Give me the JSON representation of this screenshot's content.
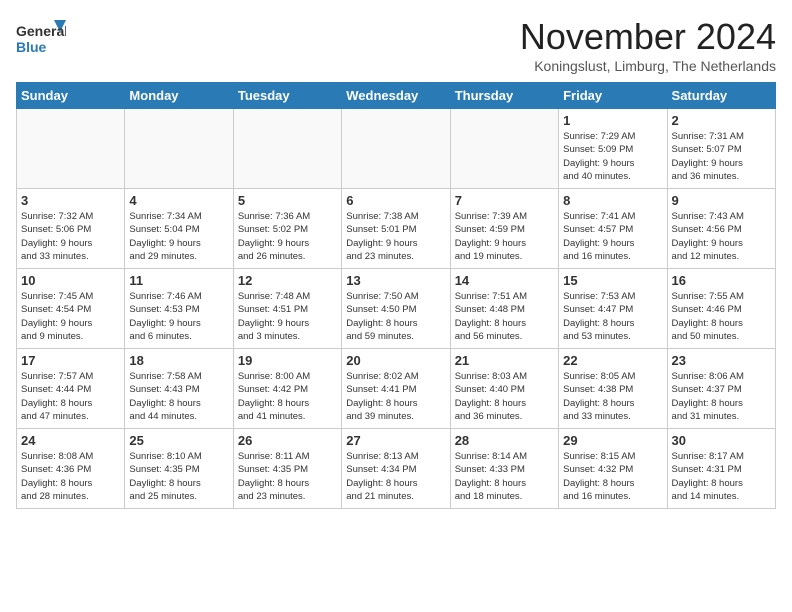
{
  "logo": {
    "general": "General",
    "blue": "Blue"
  },
  "header": {
    "month": "November 2024",
    "location": "Koningslust, Limburg, The Netherlands"
  },
  "weekdays": [
    "Sunday",
    "Monday",
    "Tuesday",
    "Wednesday",
    "Thursday",
    "Friday",
    "Saturday"
  ],
  "weeks": [
    [
      {
        "day": "",
        "info": ""
      },
      {
        "day": "",
        "info": ""
      },
      {
        "day": "",
        "info": ""
      },
      {
        "day": "",
        "info": ""
      },
      {
        "day": "",
        "info": ""
      },
      {
        "day": "1",
        "info": "Sunrise: 7:29 AM\nSunset: 5:09 PM\nDaylight: 9 hours\nand 40 minutes."
      },
      {
        "day": "2",
        "info": "Sunrise: 7:31 AM\nSunset: 5:07 PM\nDaylight: 9 hours\nand 36 minutes."
      }
    ],
    [
      {
        "day": "3",
        "info": "Sunrise: 7:32 AM\nSunset: 5:06 PM\nDaylight: 9 hours\nand 33 minutes."
      },
      {
        "day": "4",
        "info": "Sunrise: 7:34 AM\nSunset: 5:04 PM\nDaylight: 9 hours\nand 29 minutes."
      },
      {
        "day": "5",
        "info": "Sunrise: 7:36 AM\nSunset: 5:02 PM\nDaylight: 9 hours\nand 26 minutes."
      },
      {
        "day": "6",
        "info": "Sunrise: 7:38 AM\nSunset: 5:01 PM\nDaylight: 9 hours\nand 23 minutes."
      },
      {
        "day": "7",
        "info": "Sunrise: 7:39 AM\nSunset: 4:59 PM\nDaylight: 9 hours\nand 19 minutes."
      },
      {
        "day": "8",
        "info": "Sunrise: 7:41 AM\nSunset: 4:57 PM\nDaylight: 9 hours\nand 16 minutes."
      },
      {
        "day": "9",
        "info": "Sunrise: 7:43 AM\nSunset: 4:56 PM\nDaylight: 9 hours\nand 12 minutes."
      }
    ],
    [
      {
        "day": "10",
        "info": "Sunrise: 7:45 AM\nSunset: 4:54 PM\nDaylight: 9 hours\nand 9 minutes."
      },
      {
        "day": "11",
        "info": "Sunrise: 7:46 AM\nSunset: 4:53 PM\nDaylight: 9 hours\nand 6 minutes."
      },
      {
        "day": "12",
        "info": "Sunrise: 7:48 AM\nSunset: 4:51 PM\nDaylight: 9 hours\nand 3 minutes."
      },
      {
        "day": "13",
        "info": "Sunrise: 7:50 AM\nSunset: 4:50 PM\nDaylight: 8 hours\nand 59 minutes."
      },
      {
        "day": "14",
        "info": "Sunrise: 7:51 AM\nSunset: 4:48 PM\nDaylight: 8 hours\nand 56 minutes."
      },
      {
        "day": "15",
        "info": "Sunrise: 7:53 AM\nSunset: 4:47 PM\nDaylight: 8 hours\nand 53 minutes."
      },
      {
        "day": "16",
        "info": "Sunrise: 7:55 AM\nSunset: 4:46 PM\nDaylight: 8 hours\nand 50 minutes."
      }
    ],
    [
      {
        "day": "17",
        "info": "Sunrise: 7:57 AM\nSunset: 4:44 PM\nDaylight: 8 hours\nand 47 minutes."
      },
      {
        "day": "18",
        "info": "Sunrise: 7:58 AM\nSunset: 4:43 PM\nDaylight: 8 hours\nand 44 minutes."
      },
      {
        "day": "19",
        "info": "Sunrise: 8:00 AM\nSunset: 4:42 PM\nDaylight: 8 hours\nand 41 minutes."
      },
      {
        "day": "20",
        "info": "Sunrise: 8:02 AM\nSunset: 4:41 PM\nDaylight: 8 hours\nand 39 minutes."
      },
      {
        "day": "21",
        "info": "Sunrise: 8:03 AM\nSunset: 4:40 PM\nDaylight: 8 hours\nand 36 minutes."
      },
      {
        "day": "22",
        "info": "Sunrise: 8:05 AM\nSunset: 4:38 PM\nDaylight: 8 hours\nand 33 minutes."
      },
      {
        "day": "23",
        "info": "Sunrise: 8:06 AM\nSunset: 4:37 PM\nDaylight: 8 hours\nand 31 minutes."
      }
    ],
    [
      {
        "day": "24",
        "info": "Sunrise: 8:08 AM\nSunset: 4:36 PM\nDaylight: 8 hours\nand 28 minutes."
      },
      {
        "day": "25",
        "info": "Sunrise: 8:10 AM\nSunset: 4:35 PM\nDaylight: 8 hours\nand 25 minutes."
      },
      {
        "day": "26",
        "info": "Sunrise: 8:11 AM\nSunset: 4:35 PM\nDaylight: 8 hours\nand 23 minutes."
      },
      {
        "day": "27",
        "info": "Sunrise: 8:13 AM\nSunset: 4:34 PM\nDaylight: 8 hours\nand 21 minutes."
      },
      {
        "day": "28",
        "info": "Sunrise: 8:14 AM\nSunset: 4:33 PM\nDaylight: 8 hours\nand 18 minutes."
      },
      {
        "day": "29",
        "info": "Sunrise: 8:15 AM\nSunset: 4:32 PM\nDaylight: 8 hours\nand 16 minutes."
      },
      {
        "day": "30",
        "info": "Sunrise: 8:17 AM\nSunset: 4:31 PM\nDaylight: 8 hours\nand 14 minutes."
      }
    ]
  ]
}
